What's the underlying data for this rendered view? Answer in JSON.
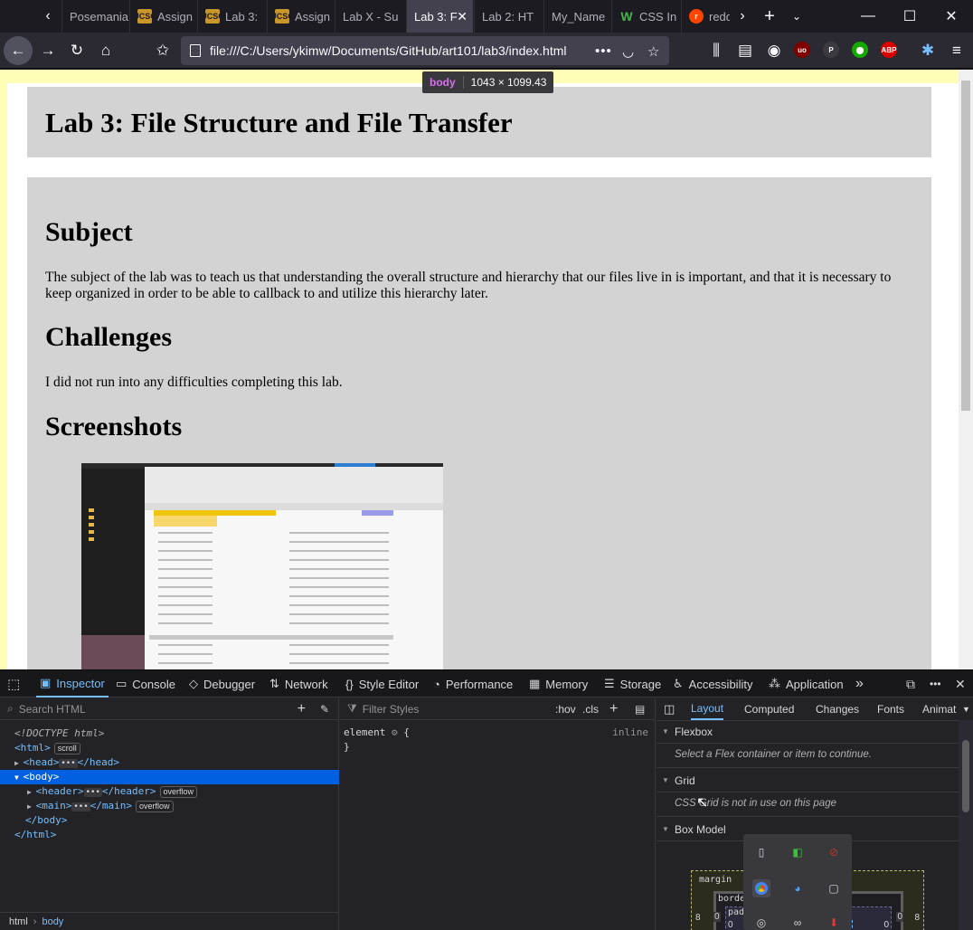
{
  "tabs": [
    {
      "label": "Posemania",
      "icon": "none-icon",
      "active": false
    },
    {
      "label": "Assign",
      "icon": "ucsc-icon",
      "active": false
    },
    {
      "label": "Lab 3:",
      "icon": "ucsc-icon",
      "active": false
    },
    {
      "label": "Assign",
      "icon": "ucsc-icon",
      "active": false
    },
    {
      "label": "Lab X - Su",
      "icon": "none-icon",
      "active": false
    },
    {
      "label": "Lab 3: F",
      "icon": "none-icon",
      "active": true
    },
    {
      "label": "Lab 2: HT",
      "icon": "none-icon",
      "active": false
    },
    {
      "label": "My_Name",
      "icon": "none-icon",
      "active": false
    },
    {
      "label": "CSS In",
      "icon": "w-icon",
      "active": false
    },
    {
      "label": "redd",
      "icon": "reddit-icon",
      "active": false
    }
  ],
  "url": "file:///C:/Users/ykimw/Documents/GitHub/art101/lab3/index.html",
  "favicon_labels": {
    "ucsc": "UCSC",
    "w": "W",
    "reddit": "r"
  },
  "ext_labels": {
    "ublock": "uo",
    "abp": "ABP"
  },
  "tooltip": {
    "tag": "body",
    "size": "1043 × 1099.43"
  },
  "page": {
    "title": "Lab 3: File Structure and File Transfer",
    "sections": [
      {
        "heading": "Subject",
        "text": "The subject of the lab was to teach us that understanding the overall structure and hierarchy that our files live in is important, and that it is necessary to keep organized in order to be able to callback to and utilize this hierarchy later."
      },
      {
        "heading": "Challenges",
        "text": "I did not run into any difficulties completing this lab."
      },
      {
        "heading": "Screenshots",
        "text": ""
      }
    ]
  },
  "devtools": {
    "tabs": [
      "Inspector",
      "Console",
      "Debugger",
      "Network",
      "Style Editor",
      "Performance",
      "Memory",
      "Storage",
      "Accessibility",
      "Application"
    ],
    "search_placeholder": "Search HTML",
    "markup": {
      "doctype": "<!DOCTYPE html>",
      "html_open": "<html>",
      "scroll_badge": "scroll",
      "head_open": "<head>",
      "head_close": "</head>",
      "body_open": "<body>",
      "header_open": "<header>",
      "header_close": "</header>",
      "main_open": "<main>",
      "main_close": "</main>",
      "overflow_badge": "overflow",
      "body_close": "</body>",
      "html_close": "</html>",
      "ellipsis": "•••"
    },
    "breadcrumbs": [
      "html",
      "body"
    ],
    "rules": {
      "filter_placeholder": "Filter Styles",
      "hov": ":hov",
      "cls": ".cls",
      "selector": "element",
      "open_brace": "{",
      "close_brace": "}",
      "origin": "inline"
    },
    "layout": {
      "tabs": [
        "Layout",
        "Computed",
        "Changes",
        "Fonts",
        "Animat"
      ],
      "flexbox_title": "Flexbox",
      "flexbox_msg": "Select a Flex container or item to continue.",
      "grid_title": "Grid",
      "grid_msg": "CSS Grid is not in use on this page",
      "boxmodel_title": "Box Model",
      "margin_label": "margin",
      "border_label": "borde",
      "padding_label": "pad",
      "margin_left": "8",
      "border_left": "0",
      "padding_left": "0",
      "margin_right": "8",
      "border_right": "0",
      "padding_right": "0"
    }
  },
  "colors": {
    "accent": "#75bfff",
    "selected": "#0060df",
    "page_panel": "#d3d3d3"
  }
}
